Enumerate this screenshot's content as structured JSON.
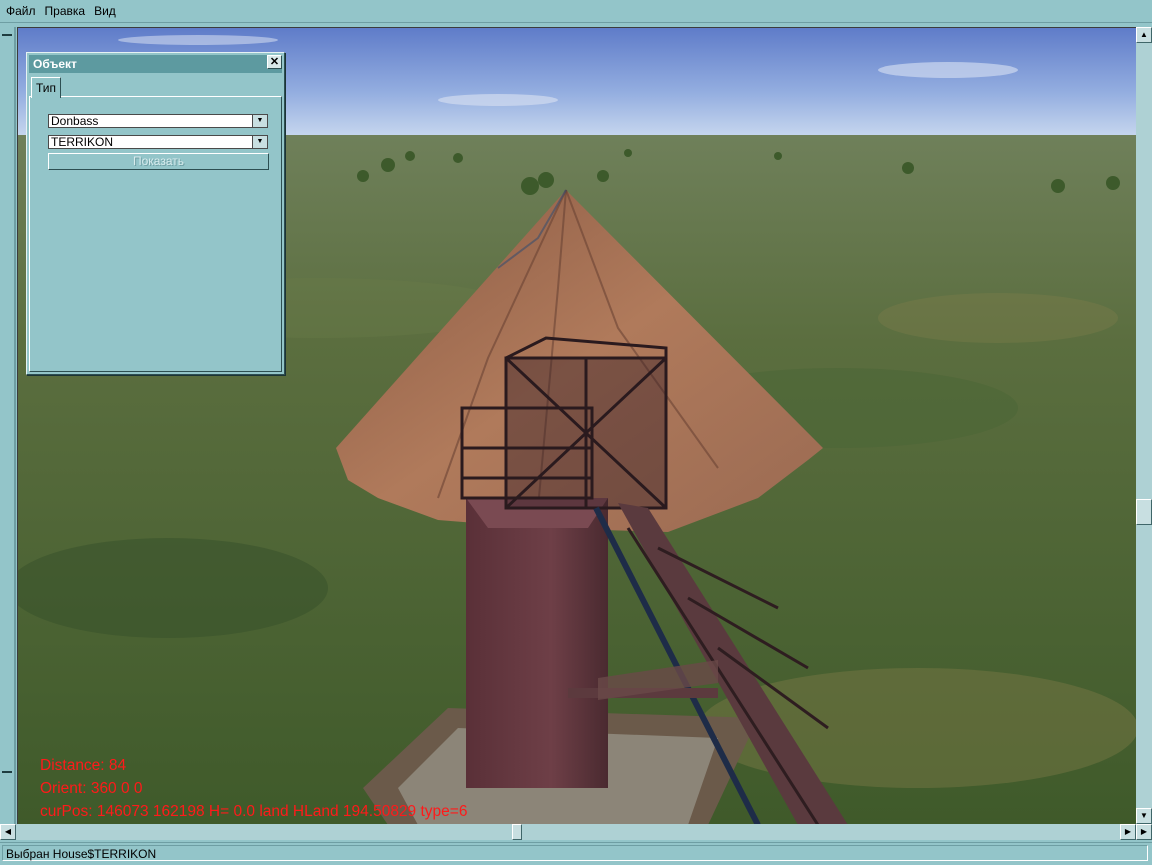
{
  "menu": {
    "items": [
      "Файл",
      "Правка",
      "Вид"
    ]
  },
  "panel": {
    "title": "Объект",
    "close_glyph": "✕",
    "tab_label": "Тип",
    "region_select": {
      "value": "Donbass"
    },
    "type_select": {
      "value": "TERRIKON"
    },
    "show_button": "Показать"
  },
  "hud": {
    "distance": "Distance: 84",
    "orient": "Orient: 360 0 0",
    "cur_pos": "curPos: 146073 162198 H= 0.0 land HLand 194.50829 type=6"
  },
  "status": {
    "text": "Выбран House$TERRIKON"
  },
  "colors": {
    "chrome": "#93c5c9",
    "title_bar": "#5d9aa0",
    "hud_text": "#ff1a1a"
  }
}
